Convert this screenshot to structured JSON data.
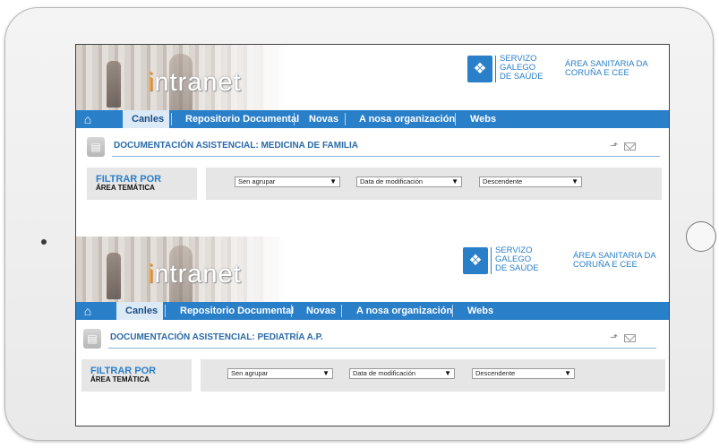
{
  "sections": [
    {
      "banner": {
        "logo_first": "i",
        "logo_rest": "ntranet",
        "logo_glyph": "❖",
        "sgs_line1": "SERVIZO",
        "sgs_line2": "GALEGO",
        "sgs_line3": "DE SAÚDE",
        "area_line1": "ÁREA SANITARIA DA",
        "area_line2": "CORUÑA E CEE"
      },
      "nav": {
        "home_icon": "⌂",
        "items": [
          "Canles",
          "Repositorio Documental",
          "Novas",
          "A nosa organización",
          "Webs"
        ]
      },
      "doc": {
        "icon": "▤",
        "title": "DOCUMENTACIÓN ASISTENCIAL: MEDICINA DE FAMILIA",
        "share_icon": "⬏"
      },
      "filter": {
        "title": "FILTRAR POR",
        "subtitle": "ÁREA TEMÁTICA",
        "group_select": "Sen agrupar",
        "sort_select": "Data de modificación",
        "order_select": "Descendente",
        "arrow": "▼"
      }
    },
    {
      "banner": {
        "logo_first": "i",
        "logo_rest": "ntranet",
        "logo_glyph": "❖",
        "sgs_line1": "SERVIZO",
        "sgs_line2": "GALEGO",
        "sgs_line3": "DE SAÚDE",
        "area_line1": "ÁREA SANITARIA DA",
        "area_line2": "CORUÑA E CEE"
      },
      "nav": {
        "home_icon": "⌂",
        "items": [
          "Canles",
          "Repositorio Documental",
          "Novas",
          "A nosa organización",
          "Webs"
        ]
      },
      "doc": {
        "icon": "▤",
        "title": "DOCUMENTACIÓN ASISTENCIAL: PEDIATRÍA A.P.",
        "share_icon": "⬏"
      },
      "filter": {
        "title": "FILTRAR POR",
        "subtitle": "ÁREA TEMÁTICA",
        "group_select": "Sen agrupar",
        "sort_select": "Data de modificación",
        "order_select": "Descendente",
        "arrow": "▼"
      }
    }
  ],
  "colors": {
    "accent": "#2a7fc9",
    "nav_active_bg": "#dce9f6",
    "filter_bg": "#e6e6e6"
  }
}
